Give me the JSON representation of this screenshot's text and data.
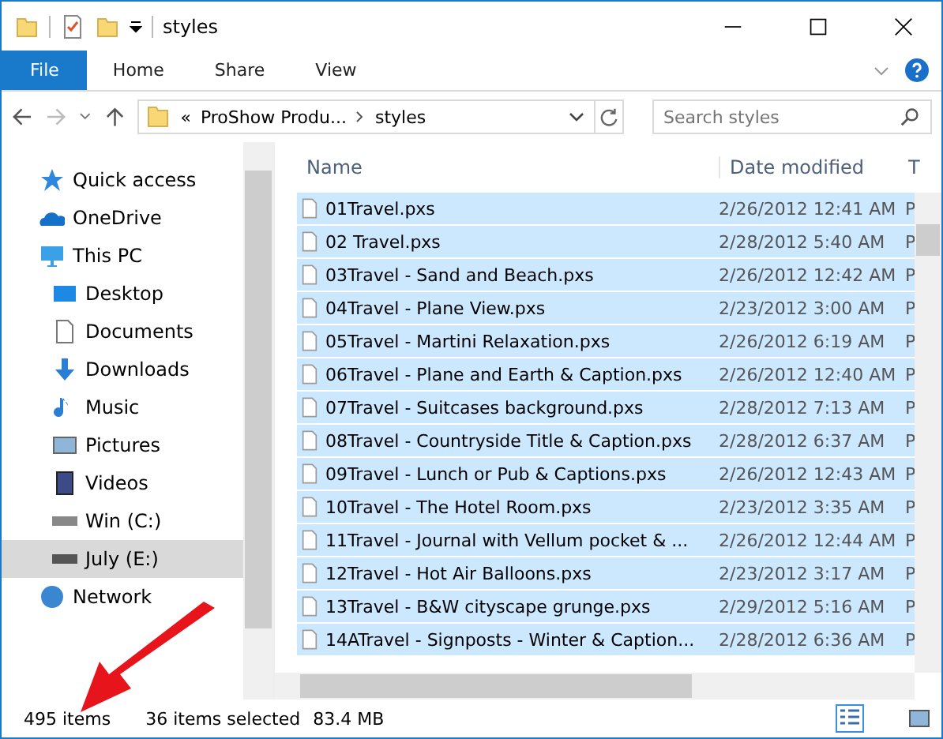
{
  "window": {
    "title": "styles"
  },
  "ribbon": {
    "tabs": [
      {
        "label": "File",
        "selected": true
      },
      {
        "label": "Home",
        "selected": false
      },
      {
        "label": "Share",
        "selected": false
      },
      {
        "label": "View",
        "selected": false
      }
    ]
  },
  "address": {
    "crumbs": [
      "«",
      "ProShow Produ...",
      "styles"
    ],
    "search": {
      "placeholder": "Search styles"
    }
  },
  "sidebar": {
    "items": [
      {
        "label": "Quick access",
        "selected": false
      },
      {
        "label": "OneDrive",
        "selected": false
      },
      {
        "label": "This PC",
        "selected": false,
        "children": [
          {
            "label": "Desktop",
            "selected": false
          },
          {
            "label": "Documents",
            "selected": false
          },
          {
            "label": "Downloads",
            "selected": false
          },
          {
            "label": "Music",
            "selected": false
          },
          {
            "label": "Pictures",
            "selected": false
          },
          {
            "label": "Videos",
            "selected": false
          },
          {
            "label": "Win (C:)",
            "selected": false
          },
          {
            "label": "July (E:)",
            "selected": true
          }
        ]
      },
      {
        "label": "Network",
        "selected": false
      }
    ]
  },
  "table": {
    "columns": [
      "Name",
      "Date modified",
      "T"
    ],
    "rows": [
      {
        "name": "01Travel.pxs",
        "date": "2/26/2012 12:41 AM",
        "type": "P",
        "selected": true
      },
      {
        "name": "02 Travel.pxs",
        "date": "2/28/2012 5:40 AM",
        "type": "P",
        "selected": true
      },
      {
        "name": "03Travel - Sand and Beach.pxs",
        "date": "2/26/2012 12:42 AM",
        "type": "P",
        "selected": true
      },
      {
        "name": "04Travel - Plane View.pxs",
        "date": "2/23/2012 3:00 AM",
        "type": "P",
        "selected": true
      },
      {
        "name": "05Travel - Martini Relaxation.pxs",
        "date": "2/26/2012 6:19 AM",
        "type": "P",
        "selected": true
      },
      {
        "name": "06Travel - Plane and Earth & Caption.pxs",
        "date": "2/26/2012 12:40 AM",
        "type": "P",
        "selected": true
      },
      {
        "name": "07Travel - Suitcases background.pxs",
        "date": "2/28/2012 7:13 AM",
        "type": "P",
        "selected": true
      },
      {
        "name": "08Travel  - Countryside Title & Caption.pxs",
        "date": "2/28/2012 6:37 AM",
        "type": "P",
        "selected": true
      },
      {
        "name": "09Travel - Lunch or Pub & Captions.pxs",
        "date": "2/26/2012 12:43 AM",
        "type": "P",
        "selected": true
      },
      {
        "name": "10Travel - The Hotel Room.pxs",
        "date": "2/23/2012 3:35 AM",
        "type": "P",
        "selected": true
      },
      {
        "name": "11Travel - Journal with Vellum pocket & ...",
        "date": "2/26/2012 12:44 AM",
        "type": "P",
        "selected": true
      },
      {
        "name": "12Travel - Hot Air Balloons.pxs",
        "date": "2/23/2012 3:17 AM",
        "type": "P",
        "selected": true
      },
      {
        "name": "13Travel - B&W cityscape grunge.pxs",
        "date": "2/29/2012 5:16 AM",
        "type": "P",
        "selected": true
      },
      {
        "name": "14ATravel - Signposts - Winter & Caption...",
        "date": "2/28/2012 6:36 AM",
        "type": "P",
        "selected": true
      }
    ]
  },
  "status_bar": {
    "count": "495 items",
    "selection": "36 items selected",
    "size": "83.4 MB"
  }
}
